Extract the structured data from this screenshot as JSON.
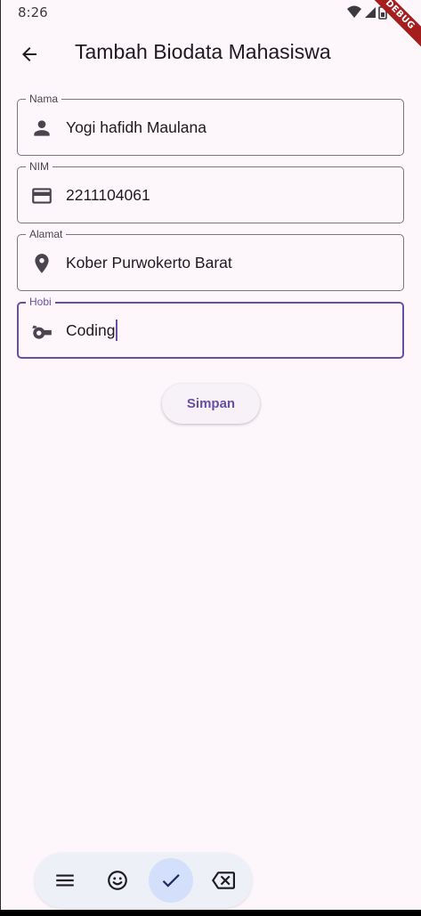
{
  "status_bar": {
    "time": "8:26",
    "icons": [
      "wifi-icon",
      "signal-icon",
      "battery-icon"
    ]
  },
  "debug_banner": "DEBUG",
  "app_bar": {
    "back_icon": "arrow-back-icon",
    "title": "Tambah Biodata Mahasiswa"
  },
  "form": {
    "fields": [
      {
        "label": "Nama",
        "value": "Yogi hafidh Maulana",
        "icon": "person-icon"
      },
      {
        "label": "NIM",
        "value": "2211104061",
        "icon": "credit-card-icon"
      },
      {
        "label": "Alamat",
        "value": "Kober Purwokerto Barat",
        "icon": "location-pin-icon"
      },
      {
        "label": "Hobi",
        "value": "Coding",
        "icon": "sports-whistle-icon",
        "focused": true
      }
    ],
    "submit_label": "Simpan"
  },
  "keyboard_toolbar": {
    "buttons": [
      "menu-icon",
      "emoji-icon",
      "check-icon",
      "backspace-icon"
    ],
    "active": "check-icon"
  },
  "colors": {
    "primary": "#6750a4",
    "background": "#fdf7fc",
    "outline": "#79747e",
    "on_surface": "#1d1b20",
    "icon": "#49454f",
    "debug": "#a51e1e",
    "keyboard_active": "#d4e0fb"
  }
}
